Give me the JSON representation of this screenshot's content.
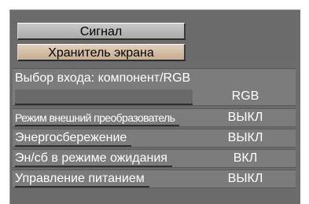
{
  "menu": {
    "signal_button": "Сигнал",
    "screensaver_button": "Хранитель экрана",
    "input_select": {
      "label": "Выбор входа: компонент/RGB",
      "value": "RGB"
    },
    "rows": [
      {
        "label": "Режим внешний преобразователь",
        "value": "ВЫКЛ"
      },
      {
        "label": "Энергосбережение",
        "value": "ВЫКЛ"
      },
      {
        "label": "Эн/сб в режиме ожидания",
        "value": "ВКЛ"
      },
      {
        "label": "Управление питанием",
        "value": "ВЫКЛ"
      }
    ]
  }
}
